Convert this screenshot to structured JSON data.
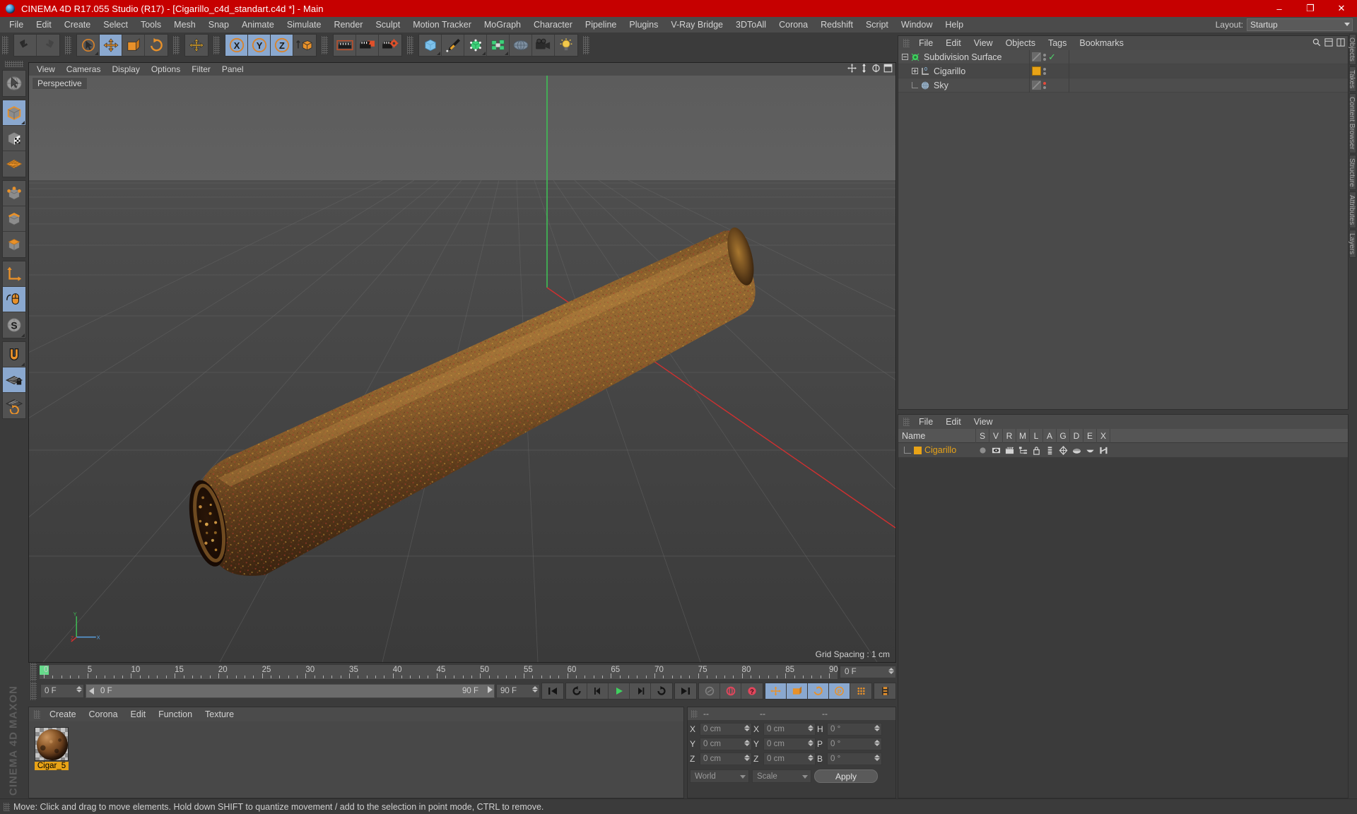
{
  "titlebar": {
    "title": "CINEMA 4D R17.055 Studio (R17) - [Cigarillo_c4d_standart.c4d *] - Main",
    "minimize": "–",
    "maximize": "❐",
    "close": "✕"
  },
  "menubar": {
    "items": [
      "File",
      "Edit",
      "Create",
      "Select",
      "Tools",
      "Mesh",
      "Snap",
      "Animate",
      "Simulate",
      "Render",
      "Sculpt",
      "Motion Tracker",
      "MoGraph",
      "Character",
      "Pipeline",
      "Plugins",
      "V-Ray Bridge",
      "3DToAll",
      "Corona",
      "Redshift",
      "Script",
      "Window",
      "Help"
    ]
  },
  "layout": {
    "label": "Layout:",
    "value": "Startup"
  },
  "toolbar": {
    "groups": [
      {
        "name": "undo-redo",
        "icons": [
          {
            "name": "undo-icon",
            "sel": false
          },
          {
            "name": "redo-icon",
            "sel": false
          }
        ]
      },
      {
        "name": "transform-tools",
        "icons": [
          {
            "name": "select-tool-icon",
            "sel": false
          },
          {
            "name": "move-tool-icon",
            "sel": true
          },
          {
            "name": "scale-tool-icon",
            "sel": false
          },
          {
            "name": "rotate-tool-icon",
            "sel": false
          }
        ]
      },
      {
        "name": "world-axis",
        "icons": [
          {
            "name": "move-axis-icon",
            "sel": false
          }
        ]
      },
      {
        "name": "axis-locks",
        "icons": [
          {
            "name": "lock-x-axis-icon",
            "sel": true,
            "label": "X"
          },
          {
            "name": "lock-y-axis-icon",
            "sel": true,
            "label": "Y"
          },
          {
            "name": "lock-z-axis-icon",
            "sel": true,
            "label": "Z"
          },
          {
            "name": "world-object-coordinate-icon",
            "sel": false
          }
        ]
      },
      {
        "name": "render-tools",
        "icons": [
          {
            "name": "render-view-icon",
            "sel": false
          },
          {
            "name": "render-to-picture-viewer-icon",
            "sel": false
          },
          {
            "name": "render-settings-icon",
            "sel": false
          }
        ]
      },
      {
        "name": "object-creation",
        "icons": [
          {
            "name": "add-cube-primitive-icon",
            "sel": false
          },
          {
            "name": "add-spline-pen-icon",
            "sel": false
          },
          {
            "name": "add-generator-icon",
            "sel": false
          },
          {
            "name": "add-deformer-icon",
            "sel": false
          },
          {
            "name": "add-environment-icon",
            "sel": false
          },
          {
            "name": "add-camera-icon",
            "sel": false
          },
          {
            "name": "add-light-icon",
            "sel": false
          }
        ]
      }
    ]
  },
  "lefttools": {
    "groups": [
      {
        "name": "live-selection",
        "icons": [
          {
            "name": "live-selection-icon",
            "sel": false
          }
        ]
      },
      {
        "name": "modes",
        "icons": [
          {
            "name": "model-mode-icon",
            "sel": true
          },
          {
            "name": "texture-mode-icon",
            "sel": false
          },
          {
            "name": "uv-mesh-mode-icon",
            "sel": false
          }
        ]
      },
      {
        "name": "components",
        "icons": [
          {
            "name": "points-mode-icon",
            "sel": false
          },
          {
            "name": "edges-mode-icon",
            "sel": false
          },
          {
            "name": "polygons-mode-icon",
            "sel": false
          }
        ]
      },
      {
        "name": "axis-and-misc",
        "icons": [
          {
            "name": "enable-axis-modification-icon",
            "sel": false
          },
          {
            "name": "viewport-solo-single-icon",
            "sel": true
          },
          {
            "name": "soft-selection-icon",
            "sel": false
          }
        ]
      },
      {
        "name": "snapping",
        "icons": [
          {
            "name": "snap-magnet-icon",
            "sel": false
          },
          {
            "name": "workplane-lock-icon",
            "sel": true
          },
          {
            "name": "workplane-rotate-icon",
            "sel": false
          }
        ]
      }
    ],
    "brand_line1": "MAXON",
    "brand_line2": "CINEMA 4D"
  },
  "viewport": {
    "menu": [
      "View",
      "Cameras",
      "Display",
      "Options",
      "Filter",
      "Panel"
    ],
    "tag": "Perspective",
    "grid_spacing": "Grid Spacing : 1 cm",
    "axis": {
      "x": "X",
      "y": "Y",
      "z": "Z"
    },
    "gizmos": [
      "viewport-move-icon",
      "viewport-pan-icon",
      "viewport-rotate-icon",
      "viewport-maximize-icon"
    ]
  },
  "timeline": {
    "frames": [
      "0",
      "5",
      "10",
      "15",
      "20",
      "25",
      "30",
      "35",
      "40",
      "45",
      "50",
      "55",
      "60",
      "65",
      "70",
      "75",
      "80",
      "85",
      "90"
    ],
    "current_frame_field": "0 F",
    "playhead_value": "0 F"
  },
  "transport": {
    "start_field": "0 F",
    "track_value": "0 F",
    "track_end": "90 F",
    "end_field": "90 F",
    "buttons": [
      {
        "name": "go-to-start-button",
        "sel": false
      },
      {
        "name": "go-to-previous-keyframe-button",
        "sel": false
      },
      {
        "name": "step-back-button",
        "sel": false
      },
      {
        "name": "play-button",
        "sel": false
      },
      {
        "name": "step-forward-button",
        "sel": false
      },
      {
        "name": "go-to-next-keyframe-button",
        "sel": false
      },
      {
        "name": "go-to-end-button",
        "sel": false
      },
      {
        "name": "record-active-objects-button",
        "sel": false
      },
      {
        "name": "autokeying-button",
        "sel": false
      },
      {
        "name": "keyframe-selection-button",
        "sel": false
      },
      {
        "name": "position-key-button",
        "sel": true
      },
      {
        "name": "scale-key-button",
        "sel": true
      },
      {
        "name": "rotation-key-button",
        "sel": true
      },
      {
        "name": "parameter-key-button",
        "sel": true
      },
      {
        "name": "point-level-animation-button",
        "sel": false
      },
      {
        "name": "timeline-settings-button",
        "sel": false
      }
    ]
  },
  "material_manager": {
    "menu": [
      "Create",
      "Corona",
      "Edit",
      "Function",
      "Texture"
    ],
    "materials": [
      {
        "name": "Cigar_5"
      }
    ]
  },
  "coordinates": {
    "headers": [
      "--",
      "--",
      "--"
    ],
    "rows": [
      {
        "pos_label": "X",
        "pos_value": "0 cm",
        "size_label": "X",
        "size_value": "0 cm",
        "rot_label": "H",
        "rot_value": "0 °"
      },
      {
        "pos_label": "Y",
        "pos_value": "0 cm",
        "size_label": "Y",
        "size_value": "0 cm",
        "rot_label": "P",
        "rot_value": "0 °"
      },
      {
        "pos_label": "Z",
        "pos_value": "0 cm",
        "size_label": "Z",
        "size_value": "0 cm",
        "rot_label": "B",
        "rot_value": "0 °"
      }
    ],
    "world_select": "World",
    "scale_select": "Scale",
    "apply_button": "Apply"
  },
  "object_manager": {
    "menu": [
      "File",
      "Edit",
      "View",
      "Objects",
      "Tags",
      "Bookmarks"
    ],
    "rows": [
      {
        "name": "Subdivision Surface",
        "indent": 0,
        "expander": "minus",
        "icon": "subdivision-surface-icon",
        "tag": "checker",
        "dots": "gray",
        "check": true
      },
      {
        "name": "Cigarillo",
        "indent": 1,
        "expander": "plus",
        "icon": "null-object-icon",
        "tag": "orange",
        "dots": "gray",
        "check": false
      },
      {
        "name": "Sky",
        "indent": 1,
        "expander": "none",
        "icon": "sky-object-icon",
        "tag": "checker",
        "dots": "red",
        "check": false
      }
    ]
  },
  "attribute_manager": {
    "menu": [
      "File",
      "Edit",
      "View"
    ],
    "columns": [
      "Name",
      "S",
      "V",
      "R",
      "M",
      "L",
      "A",
      "G",
      "D",
      "E",
      "X"
    ],
    "rows": [
      {
        "name": "Cigarillo",
        "cells": [
          "solo-dot-icon",
          "visibility-eye-icon",
          "render-clapper-icon",
          "hierarchy-icon",
          "lock-icon",
          "animation-icon",
          "generator-icon",
          "deformer-icon",
          "expression-icon",
          "xref-icon"
        ]
      }
    ]
  },
  "right_tabs": [
    "Objects",
    "Takes",
    "Content Browser",
    "Structure",
    "Attributes",
    "Layers"
  ],
  "statusbar": {
    "message": "Move: Click and drag to move elements. Hold down SHIFT to quantize movement / add to the selection in point mode, CTRL to remove."
  }
}
